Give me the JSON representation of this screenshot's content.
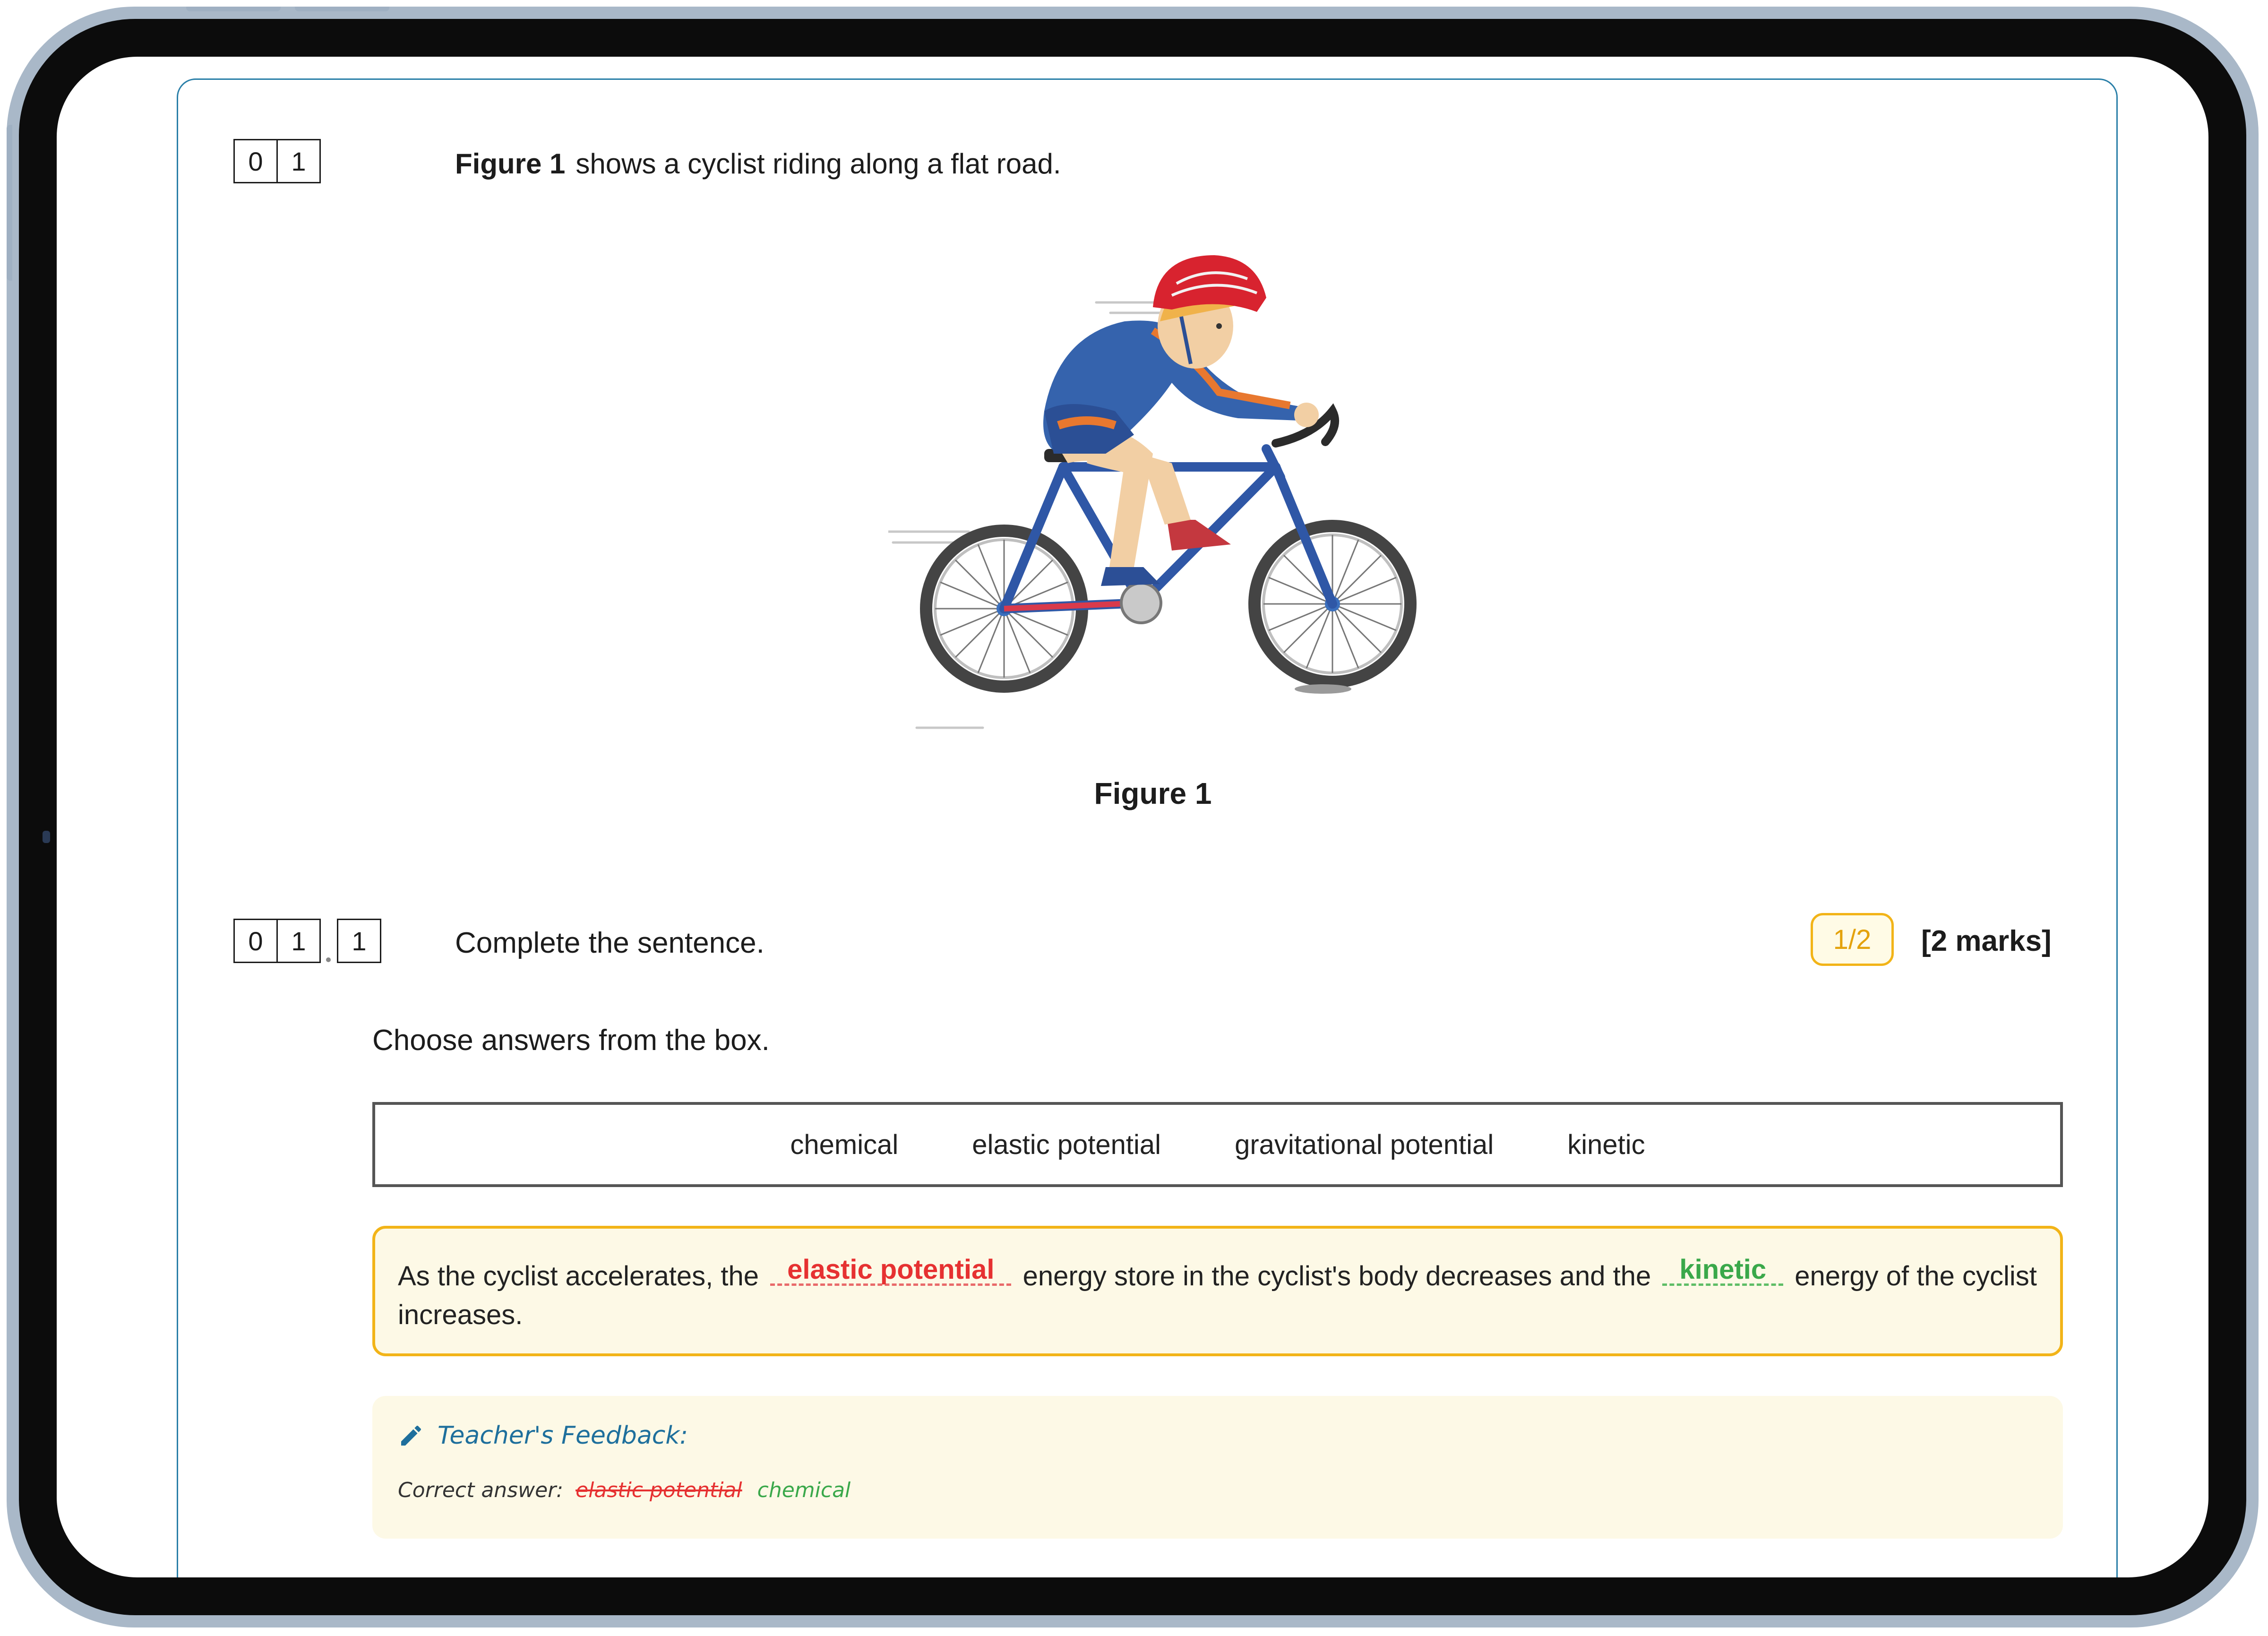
{
  "question": {
    "number_digits": [
      "0",
      "1"
    ],
    "intro_bold": "Figure 1",
    "intro_text": "shows a cyclist riding along a flat road.",
    "figure_caption": "Figure 1"
  },
  "subquestion": {
    "number_digits": [
      "0",
      "1",
      "1"
    ],
    "prompt": "Complete the sentence.",
    "score": "1/2",
    "marks": "[2 marks]",
    "instruction": "Choose answers from the box."
  },
  "word_box": {
    "options": [
      "chemical",
      "elastic potential",
      "gravitational potential",
      "kinetic"
    ]
  },
  "answer": {
    "part1": "As the cyclist accelerates, the",
    "blank1": "elastic potential",
    "part2": "energy store in the cyclist's body decreases and the",
    "blank2": "kinetic",
    "part3": "energy of the cyclist increases."
  },
  "feedback": {
    "title": "Teacher's Feedback:",
    "correct_label": "Correct answer:",
    "struck_answer": "elastic potential",
    "correct_answer": "chemical"
  },
  "colors": {
    "frame": "#a9b8c8",
    "accent_border": "#2a7fa8",
    "score_border": "#f2b418",
    "wrong": "#e63131",
    "right": "#3aa84a",
    "feedback_title": "#1e6f9c",
    "highlight_bg": "#fdf9e6"
  }
}
